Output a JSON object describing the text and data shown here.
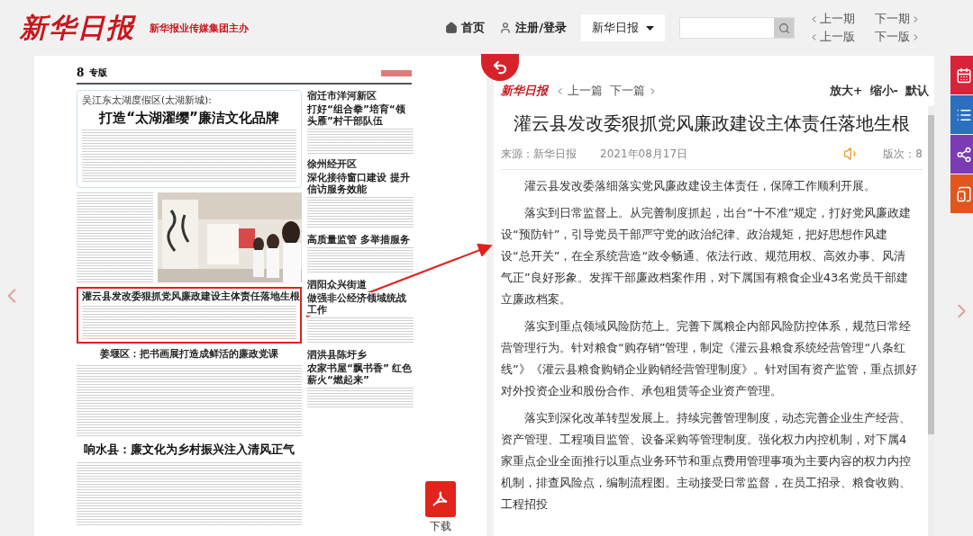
{
  "header": {
    "logo": "新华日报",
    "sub_logo": "新华报业传媒集团主办",
    "nav": [
      {
        "kind": "home",
        "label": "首页"
      },
      {
        "kind": "user",
        "label": "注册/登录"
      }
    ],
    "paper_select": "新华日报",
    "issue_nav": [
      "上一期",
      "下一期",
      "上一版",
      "下一版"
    ]
  },
  "newspaper": {
    "page_number": "8",
    "section": "专版",
    "lead_subtitle": "吴江东太湖度假区(太湖新城):",
    "lead_headline": "打造“太湖濯缨”廉洁文化品牌",
    "side_stories": [
      {
        "place": "宿迁市洋河新区",
        "title": "打好“组合拳”培育“领头雁”村干部队伍"
      },
      {
        "place": "徐州经开区",
        "title": "深化接待窗口建设 提升信访服务效能"
      },
      {
        "title": "高质量监管 多举措服务"
      },
      {
        "place": "泗阳众兴街道",
        "title": "做强非公经济领域统战工作"
      },
      {
        "place": "泗洪县陈圩乡",
        "title": "农家书屋“飘书香” 红色薪火“燃起来”"
      }
    ],
    "highlight": "灌云县发改委狠抓党风廉政建设主体责任落地生根",
    "middle_headline": "姜堰区：把书画展打造成鲜活的廉政党课",
    "bottom_headline": "响水县：廉文化为乡村振兴注入清风正气",
    "download": "下载"
  },
  "article": {
    "logo": "新华日报",
    "prev": "上一篇",
    "next": "下一篇",
    "zoom": [
      "放大+",
      "缩小-",
      "默认"
    ],
    "title": "灌云县发改委狠抓党风廉政建设主体责任落地生根",
    "source": "来源：新华日报",
    "date": "2021年08月17日",
    "edition": "版次：8",
    "paragraphs": [
      "灌云县发改委落细落实党风廉政建设主体责任，保障工作顺利开展。",
      "落实到日常监督上。从完善制度抓起，出台“十不准”规定，打好党风廉政建设“预防针”，引导党员干部严守党的政治纪律、政治规矩，把好思想作风建设“总开关”，在全系统营造“政令畅通、依法行政、规范用权、高效办事、风清气正”良好形象。发挥干部廉政档案作用，对下属国有粮食企业43名党员干部建立廉政档案。",
      "落实到重点领域风险防范上。完善下属粮企内部风险防控体系，规范日常经营管理行为。针对粮食“购存销”管理，制定《灌云县粮食系统经营管理“八条红线”》《灌云县粮食购销企业购销经营管理制度》。针对国有资产监管，重点抓好对外投资企业和股份合作、承包租赁等企业资产管理。",
      "落实到深化改革转型发展上。持续完善管理制度，动态完善企业生产经营、资产管理、工程项目监管、设备采购等管理制度。强化权力内控机制，对下属4家重点企业全面推行以重点业务环节和重点费用管理事项为主要内容的权力内控机制，排查风险点，编制流程图。主动接受日常监督，在员工招录、粮食收购、工程招投"
    ]
  },
  "side_buttons": [
    {
      "kind": "calendar",
      "color": "#d9233a"
    },
    {
      "kind": "list",
      "color": "#2a6fc0"
    },
    {
      "kind": "share",
      "color": "#7b3bb5"
    },
    {
      "kind": "tablet",
      "color": "#e0561c"
    }
  ]
}
